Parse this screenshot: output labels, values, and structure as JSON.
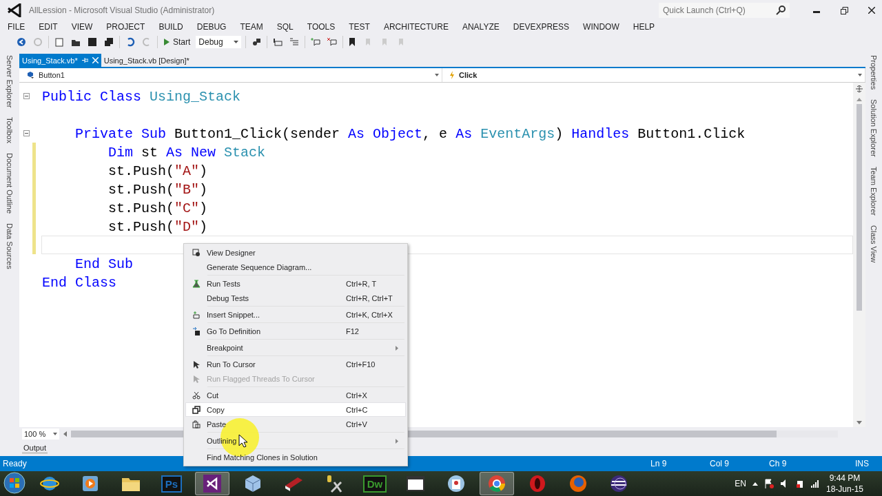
{
  "window": {
    "title": "AllLession - Microsoft Visual Studio (Administrator)",
    "quick_launch": {
      "placeholder": "Quick Launch (Ctrl+Q)"
    }
  },
  "menu_bar": [
    "FILE",
    "EDIT",
    "VIEW",
    "PROJECT",
    "BUILD",
    "DEBUG",
    "TEAM",
    "SQL",
    "TOOLS",
    "TEST",
    "ARCHITECTURE",
    "ANALYZE",
    "DEVEXPRESS",
    "WINDOW",
    "HELP"
  ],
  "toolbar": {
    "start_label": "Start",
    "configuration": "Debug"
  },
  "left_tabs": [
    "Server Explorer",
    "Toolbox",
    "Document Outline",
    "Data Sources"
  ],
  "right_tabs": [
    "Properties",
    "Solution Explorer",
    "Team Explorer",
    "Class View"
  ],
  "doc_tabs": [
    {
      "label": "Using_Stack.vb*",
      "selected": true
    },
    {
      "label": "Using_Stack.vb [Design]*",
      "selected": false
    }
  ],
  "nav": {
    "object": "Button1",
    "event": "Click"
  },
  "code": [
    {
      "kind": "code",
      "fold": true,
      "changed": false,
      "tokens": [
        {
          "kind": "keyword",
          "text": "Public Class "
        },
        {
          "kind": "type",
          "text": "Using_Stack"
        }
      ]
    },
    {
      "kind": "blank",
      "changed": false,
      "current": false
    },
    {
      "kind": "code",
      "fold": true,
      "changed": false,
      "tokens": [
        {
          "kind": "keyword",
          "text": "    Private Sub "
        },
        {
          "kind": "plain",
          "text": "Button1_Click(sender "
        },
        {
          "kind": "keyword",
          "text": "As Object"
        },
        {
          "kind": "plain",
          "text": ", e "
        },
        {
          "kind": "keyword",
          "text": "As "
        },
        {
          "kind": "type",
          "text": "EventArgs"
        },
        {
          "kind": "plain",
          "text": ") "
        },
        {
          "kind": "keyword",
          "text": "Handles"
        },
        {
          "kind": "plain",
          "text": " Button1.Click"
        }
      ]
    },
    {
      "kind": "code",
      "fold": false,
      "changed": true,
      "tokens": [
        {
          "kind": "keyword",
          "text": "        Dim "
        },
        {
          "kind": "plain",
          "text": "st "
        },
        {
          "kind": "keyword",
          "text": "As New "
        },
        {
          "kind": "type",
          "text": "Stack"
        }
      ]
    },
    {
      "kind": "code",
      "fold": false,
      "changed": true,
      "tokens": [
        {
          "kind": "plain",
          "text": "        st.Push("
        },
        {
          "kind": "string",
          "text": "\"A\""
        },
        {
          "kind": "plain",
          "text": ")"
        }
      ]
    },
    {
      "kind": "code",
      "fold": false,
      "changed": true,
      "tokens": [
        {
          "kind": "plain",
          "text": "        st.Push("
        },
        {
          "kind": "string",
          "text": "\"B\""
        },
        {
          "kind": "plain",
          "text": ")"
        }
      ]
    },
    {
      "kind": "code",
      "fold": false,
      "changed": true,
      "tokens": [
        {
          "kind": "plain",
          "text": "        st.Push("
        },
        {
          "kind": "string",
          "text": "\"C\""
        },
        {
          "kind": "plain",
          "text": ")"
        }
      ]
    },
    {
      "kind": "code",
      "fold": false,
      "changed": true,
      "tokens": [
        {
          "kind": "plain",
          "text": "        st.Push("
        },
        {
          "kind": "string",
          "text": "\"D\""
        },
        {
          "kind": "plain",
          "text": ")"
        }
      ]
    },
    {
      "kind": "blank",
      "changed": true,
      "current": true
    },
    {
      "kind": "code",
      "fold": false,
      "changed": false,
      "tokens": [
        {
          "kind": "keyword",
          "text": "    End Sub"
        }
      ]
    },
    {
      "kind": "code",
      "fold": false,
      "changed": false,
      "tokens": [
        {
          "kind": "keyword",
          "text": "End Class"
        }
      ]
    }
  ],
  "zoom": "100 %",
  "output_tab": "Output",
  "context_menu": {
    "groups": [
      [
        {
          "label": "View Designer",
          "disabled": false,
          "selected": false,
          "submenu": false
        },
        {
          "label": "Generate Sequence Diagram...",
          "disabled": false,
          "selected": false,
          "submenu": false
        }
      ],
      [
        {
          "label": "Run Tests",
          "shortcut": "Ctrl+R, T",
          "disabled": false,
          "selected": false,
          "submenu": false
        },
        {
          "label": "Debug Tests",
          "shortcut": "Ctrl+R, Ctrl+T",
          "disabled": false,
          "selected": false,
          "submenu": false
        }
      ],
      [
        {
          "label": "Insert Snippet...",
          "shortcut": "Ctrl+K, Ctrl+X",
          "disabled": false,
          "selected": false,
          "submenu": false
        }
      ],
      [
        {
          "label": "Go To Definition",
          "shortcut": "F12",
          "disabled": false,
          "selected": false,
          "submenu": false
        }
      ],
      [
        {
          "label": "Breakpoint",
          "disabled": false,
          "selected": false,
          "submenu": true
        }
      ],
      [
        {
          "label": "Run To Cursor",
          "shortcut": "Ctrl+F10",
          "disabled": false,
          "selected": false,
          "submenu": false
        },
        {
          "label": "Run Flagged Threads To Cursor",
          "disabled": true,
          "selected": false,
          "submenu": false
        }
      ],
      [
        {
          "label": "Cut",
          "shortcut": "Ctrl+X",
          "disabled": false,
          "selected": false,
          "submenu": false
        },
        {
          "label": "Copy",
          "shortcut": "Ctrl+C",
          "disabled": false,
          "selected": true,
          "submenu": false
        },
        {
          "label": "Paste",
          "shortcut": "Ctrl+V",
          "disabled": false,
          "selected": false,
          "submenu": false
        }
      ],
      [
        {
          "label": "Outlining",
          "disabled": false,
          "selected": false,
          "submenu": true
        }
      ],
      [
        {
          "label": "Find Matching Clones in Solution",
          "disabled": false,
          "selected": false,
          "submenu": false
        }
      ]
    ]
  },
  "status_bar": {
    "text": "Ready",
    "line": "Ln 9",
    "col": "Col 9",
    "ch": "Ch 9",
    "mode": "INS"
  },
  "taskbar": {
    "apps": [
      {
        "kind": "ie",
        "active": false
      },
      {
        "kind": "media",
        "active": false
      },
      {
        "kind": "folder",
        "active": false
      },
      {
        "kind": "label",
        "label": "Ps",
        "color": "#1c6fbf",
        "active": false
      },
      {
        "kind": "vs",
        "active": true
      },
      {
        "kind": "cube",
        "active": false
      },
      {
        "kind": "book",
        "active": false
      },
      {
        "kind": "tools",
        "active": false
      },
      {
        "kind": "label",
        "label": "Dw",
        "color": "#3a9a2e",
        "active": false
      },
      {
        "kind": "window",
        "active": false
      },
      {
        "kind": "contact",
        "active": false
      },
      {
        "kind": "chrome",
        "active": true
      },
      {
        "kind": "opera",
        "active": false
      },
      {
        "kind": "firefox",
        "active": false
      },
      {
        "kind": "eclipse",
        "active": false
      }
    ],
    "language": "EN",
    "time": "9:44 PM",
    "date": "18-Jun-15"
  }
}
